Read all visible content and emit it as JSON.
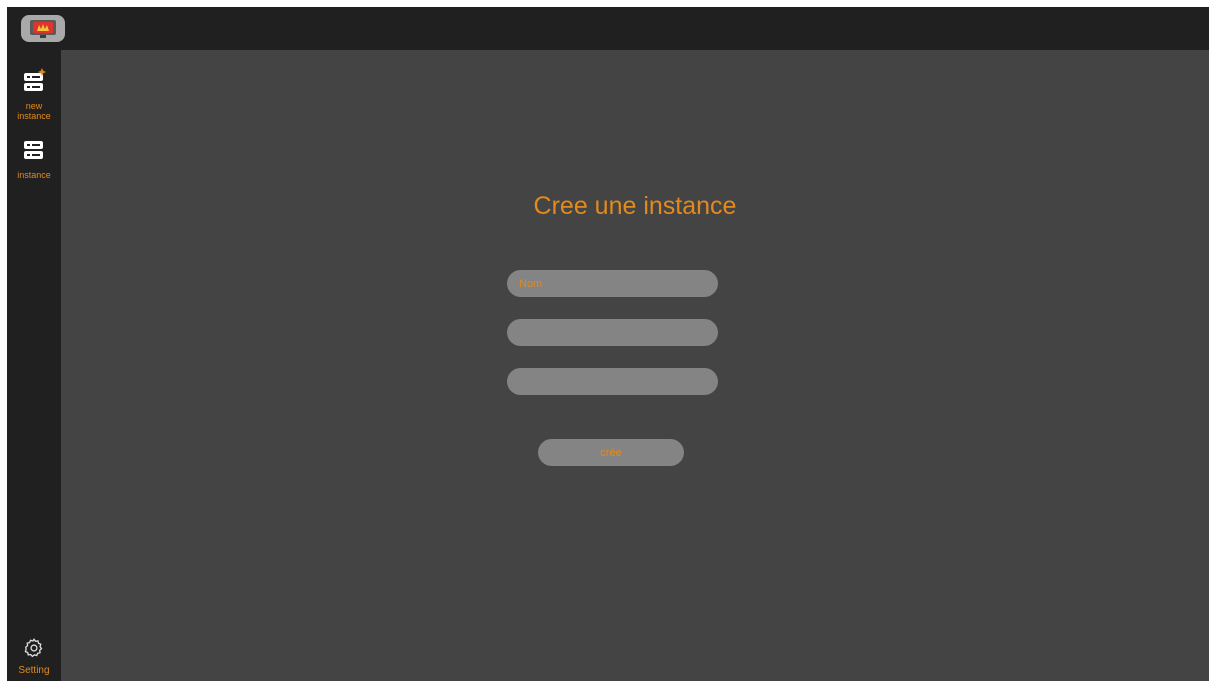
{
  "app": {
    "logo_icon": "monitor-logo-icon"
  },
  "colors": {
    "accent": "#e38a1d",
    "sidebar_bg": "#202020",
    "main_bg": "#444444",
    "field_bg": "#848484"
  },
  "sidebar": {
    "items": [
      {
        "label": "new instance",
        "icon": "server-add-icon"
      },
      {
        "label": "instance",
        "icon": "server-icon"
      }
    ],
    "footer": {
      "label": "Setting",
      "icon": "gear-icon"
    }
  },
  "form": {
    "title": "Cree une instance",
    "fields": [
      {
        "placeholder": "Nom",
        "value": ""
      },
      {
        "placeholder": "",
        "value": ""
      },
      {
        "placeholder": "",
        "value": ""
      }
    ],
    "submit_label": "crée"
  }
}
